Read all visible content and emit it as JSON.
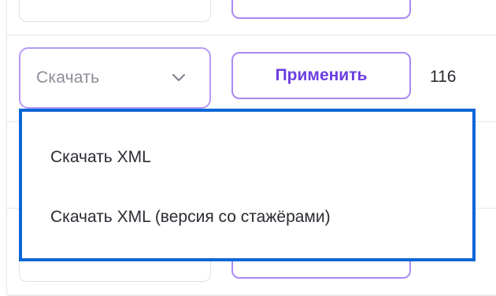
{
  "row": {
    "select": {
      "value": "Скачать"
    },
    "apply_label": "Применить",
    "count": "116"
  },
  "dropdown": {
    "items": [
      {
        "label": "Скачать XML"
      },
      {
        "label": "Скачать XML (версия со стажёрами)"
      }
    ]
  },
  "icons": {
    "select_chevron": "chevron-down-icon"
  },
  "colors": {
    "accent_purple": "#6b3fe0",
    "button_border": "#a98af4",
    "dropdown_focus_border": "#0a66d6",
    "muted_text": "#8d8d99"
  }
}
